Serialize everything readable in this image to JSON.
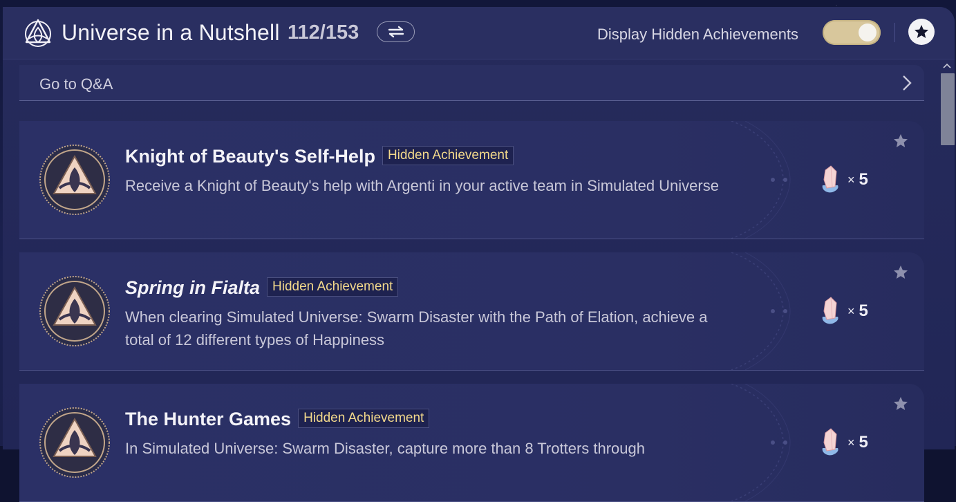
{
  "header": {
    "title": "Universe in a Nutshell",
    "progress": "112/153",
    "hidden_toggle_label": "Display Hidden Achievements",
    "hidden_toggle_on": true
  },
  "qa": {
    "label": "Go to Q&A"
  },
  "achievements": [
    {
      "title": "Knight of Beauty's Self-Help",
      "badge": "Hidden Achievement",
      "description": "Receive a Knight of Beauty's help with Argenti in your active team in Simulated Universe",
      "reward_x": "×",
      "reward_count": "5"
    },
    {
      "title": "Spring in Fialta",
      "badge": "Hidden Achievement",
      "description": "When clearing Simulated Universe: Swarm Disaster with the Path of Elation, achieve a total of 12 different types of Happiness",
      "reward_x": "×",
      "reward_count": "5"
    },
    {
      "title": "The Hunter Games",
      "badge": "Hidden Achievement",
      "description": "In Simulated Universe: Swarm Disaster, capture more than 8 Trotters through",
      "reward_x": "×",
      "reward_count": "5"
    }
  ],
  "colors": {
    "accent_badge_text": "#f3d98b",
    "toggle_on": "#d8c79c",
    "panel": "#262b5c"
  },
  "icons": {
    "logo": "trinity-knot-emblem-icon",
    "switch": "swap-arrows-icon",
    "favorite": "star-icon",
    "chevron": "chevron-right-icon",
    "reward": "stellar-jade-crystal-icon"
  }
}
